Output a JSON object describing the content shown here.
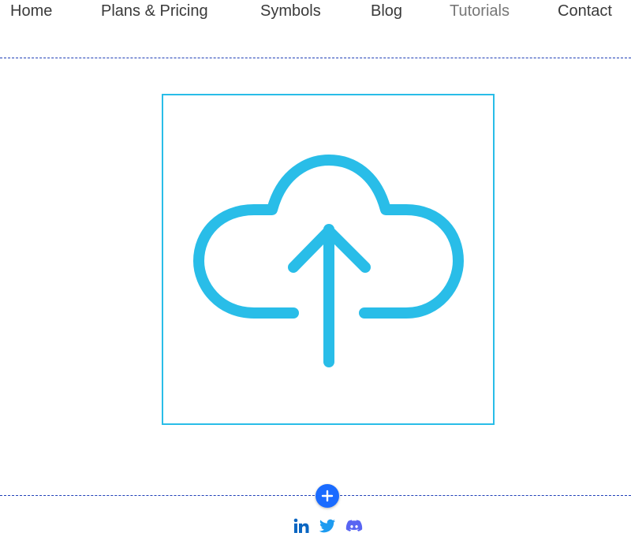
{
  "nav": {
    "items": [
      {
        "label": "Home"
      },
      {
        "label": "Plans & Pricing"
      },
      {
        "label": "Symbols"
      },
      {
        "label": "Blog"
      },
      {
        "label": "Tutorials"
      },
      {
        "label": "Contact"
      }
    ]
  },
  "main": {
    "image_icon": "cloud-upload-icon",
    "icon_color": "#29bde8"
  },
  "add_button": {
    "icon": "plus-icon",
    "color": "#1a6bff"
  },
  "social": {
    "items": [
      {
        "icon": "linkedin-icon",
        "color": "#0a66c2"
      },
      {
        "icon": "twitter-icon",
        "color": "#1d9bf0"
      },
      {
        "icon": "discord-icon",
        "color": "#5865f2"
      }
    ]
  },
  "colors": {
    "divider": "#1f3fb7",
    "nav_text": "#3a3a3a",
    "nav_muted": "#777777"
  }
}
